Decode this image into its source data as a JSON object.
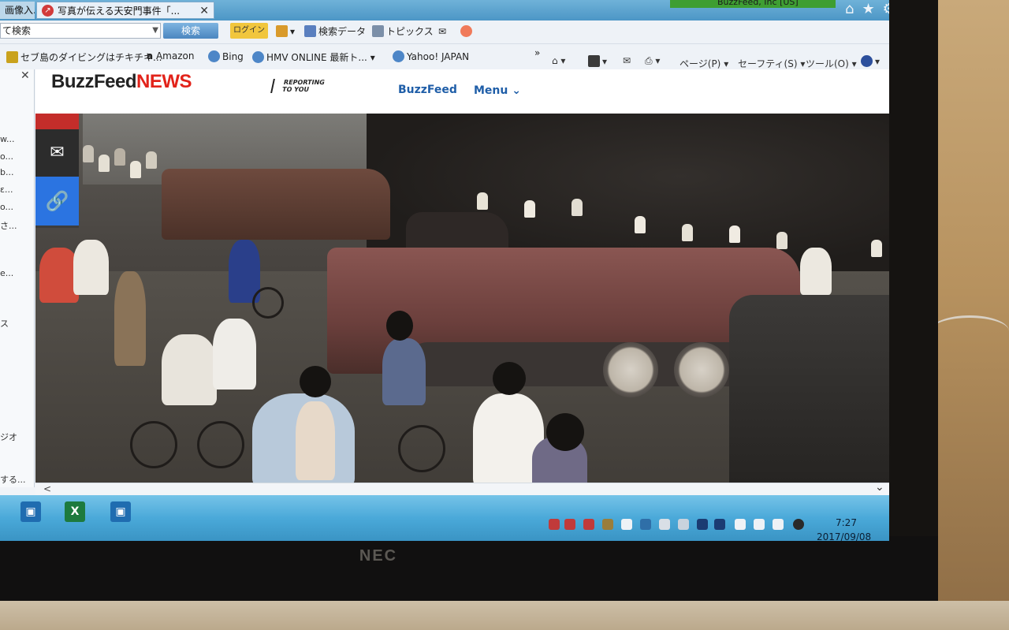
{
  "browser": {
    "tabs": [
      {
        "label": "画像入..."
      },
      {
        "label": "写真が伝える天安門事件「..."
      }
    ],
    "window_title_right": "BuzzFeed, Inc [US]",
    "search": {
      "value": "て検索",
      "button_label": "検索"
    },
    "toolbar": {
      "login_label": "ログイン",
      "search_data_label": "検索データ",
      "topics_label": "トピックス"
    },
    "favorites": [
      {
        "label": "セブ島のダイビングはチキチキ..."
      },
      {
        "label": "Amazon"
      },
      {
        "label": "Bing"
      },
      {
        "label": "HMV ONLINE 最新ト..."
      },
      {
        "label": "Yahoo! JAPAN"
      }
    ],
    "command_bar": {
      "page_label": "ページ(P)",
      "safety_label": "セーフティ(S)",
      "tools_label": "ツール(O)"
    }
  },
  "left_panel": {
    "items": [
      "w...",
      "o...",
      "b...",
      "ε...",
      "o...",
      "さ...",
      "e...",
      "ス",
      "ジオ",
      "する..."
    ]
  },
  "page": {
    "logo_main": "BuzzFeed",
    "logo_accent": "NEWS",
    "tagline_line1": "REPORTING",
    "tagline_line2": "TO YOU",
    "nav": [
      {
        "label": "BuzzFeed"
      },
      {
        "label": "Menu ⌄"
      }
    ]
  },
  "taskbar": {
    "time": "7:27",
    "date": "2017/09/08"
  },
  "bezel": {
    "brand": "NEC"
  },
  "colors": {
    "buzzfeed_red": "#e2231a",
    "nav_blue": "#1f5ea8",
    "share_link_blue": "#2b74e1",
    "taskbar_blue": "#4aa9d9"
  }
}
